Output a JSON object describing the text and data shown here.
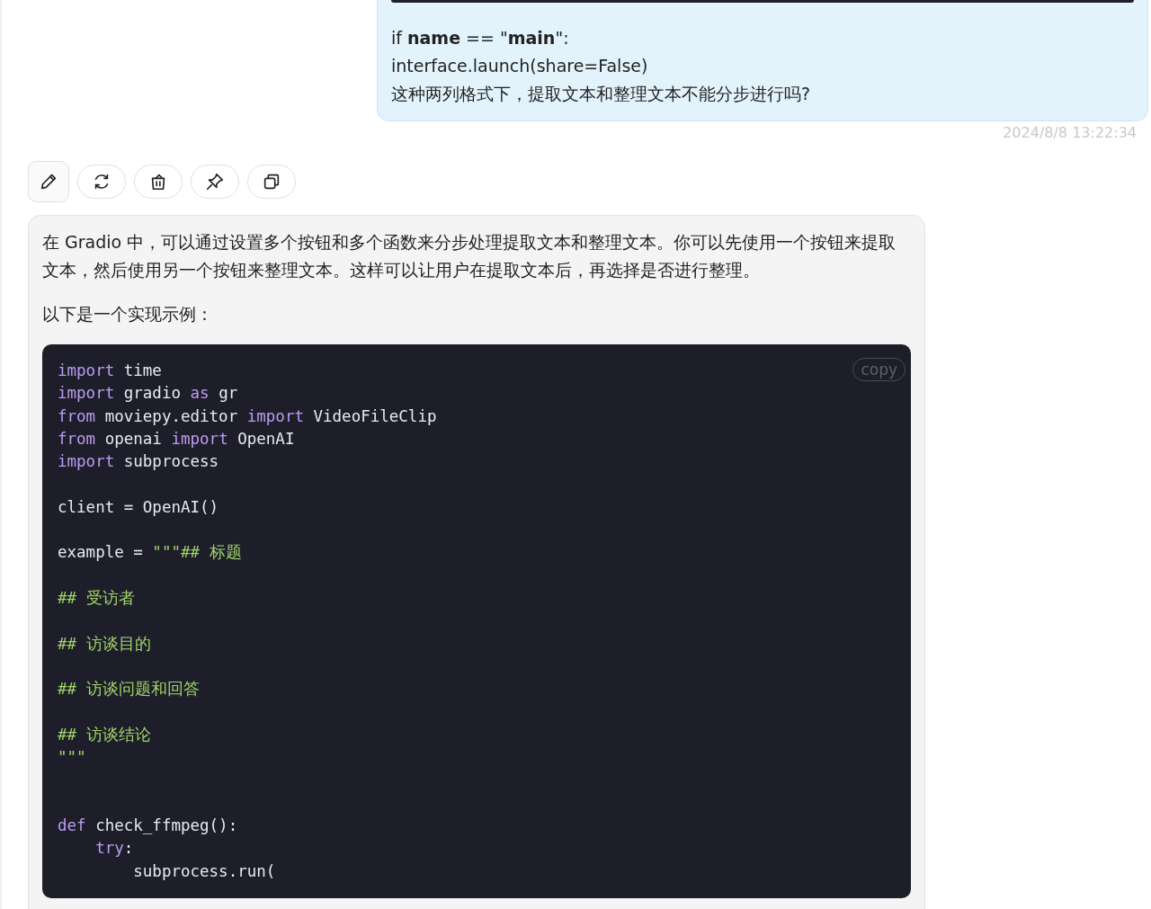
{
  "user_message": {
    "lines": [
      "if **name** == \"**main**\":",
      "interface.launch(share=False)",
      "这种两列格式下，提取文本和整理文本不能分步进行吗?"
    ],
    "timestamp": "2024/8/8 13:22:34"
  },
  "actions": [
    {
      "kind": "edit"
    },
    {
      "kind": "regenerate"
    },
    {
      "kind": "delete"
    },
    {
      "kind": "pin"
    },
    {
      "kind": "copy"
    }
  ],
  "assistant_message": {
    "paragraphs": [
      "在 Gradio 中，可以通过设置多个按钮和多个函数来分步处理提取文本和整理文本。你可以先使用一个按钮来提取文本，然后使用另一个按钮来整理文本。这样可以让用户在提取文本后，再选择是否进行整理。",
      "以下是一个实现示例："
    ],
    "code_block": {
      "copy_label": "copy",
      "lines": [
        {
          "kind": "code",
          "tokens": [
            {
              "kind": "keyword",
              "text": "import"
            },
            {
              "kind": "plain",
              "text": " time"
            }
          ]
        },
        {
          "kind": "code",
          "tokens": [
            {
              "kind": "keyword",
              "text": "import"
            },
            {
              "kind": "plain",
              "text": " gradio "
            },
            {
              "kind": "keyword",
              "text": "as"
            },
            {
              "kind": "plain",
              "text": " gr"
            }
          ]
        },
        {
          "kind": "code",
          "tokens": [
            {
              "kind": "keyword",
              "text": "from"
            },
            {
              "kind": "plain",
              "text": " moviepy.editor "
            },
            {
              "kind": "keyword",
              "text": "import"
            },
            {
              "kind": "plain",
              "text": " VideoFileClip"
            }
          ]
        },
        {
          "kind": "code",
          "tokens": [
            {
              "kind": "keyword",
              "text": "from"
            },
            {
              "kind": "plain",
              "text": " openai "
            },
            {
              "kind": "keyword",
              "text": "import"
            },
            {
              "kind": "plain",
              "text": " OpenAI"
            }
          ]
        },
        {
          "kind": "code",
          "tokens": [
            {
              "kind": "keyword",
              "text": "import"
            },
            {
              "kind": "plain",
              "text": " subprocess"
            }
          ]
        },
        {
          "kind": "blank"
        },
        {
          "kind": "code",
          "tokens": [
            {
              "kind": "plain",
              "text": "client = OpenAI()"
            }
          ]
        },
        {
          "kind": "blank"
        },
        {
          "kind": "code",
          "tokens": [
            {
              "kind": "plain",
              "text": "example = "
            },
            {
              "kind": "string",
              "text": "\"\"\"## 标题"
            }
          ]
        },
        {
          "kind": "blank"
        },
        {
          "kind": "code",
          "tokens": [
            {
              "kind": "string",
              "text": "## 受访者"
            }
          ]
        },
        {
          "kind": "blank"
        },
        {
          "kind": "code",
          "tokens": [
            {
              "kind": "string",
              "text": "## 访谈目的"
            }
          ]
        },
        {
          "kind": "blank"
        },
        {
          "kind": "code",
          "tokens": [
            {
              "kind": "string",
              "text": "## 访谈问题和回答"
            }
          ]
        },
        {
          "kind": "blank"
        },
        {
          "kind": "code",
          "tokens": [
            {
              "kind": "string",
              "text": "## 访谈结论"
            }
          ]
        },
        {
          "kind": "code",
          "tokens": [
            {
              "kind": "string",
              "text": "\"\"\""
            }
          ]
        },
        {
          "kind": "blank"
        },
        {
          "kind": "blank"
        },
        {
          "kind": "code",
          "tokens": [
            {
              "kind": "keyword",
              "text": "def"
            },
            {
              "kind": "plain",
              "text": " check_ffmpeg():"
            }
          ]
        },
        {
          "kind": "code",
          "tokens": [
            {
              "kind": "keyword",
              "text": "    try"
            },
            {
              "kind": "plain",
              "text": ":"
            }
          ]
        },
        {
          "kind": "code",
          "tokens": [
            {
              "kind": "plain",
              "text": "        subprocess.run("
            }
          ]
        }
      ]
    }
  }
}
